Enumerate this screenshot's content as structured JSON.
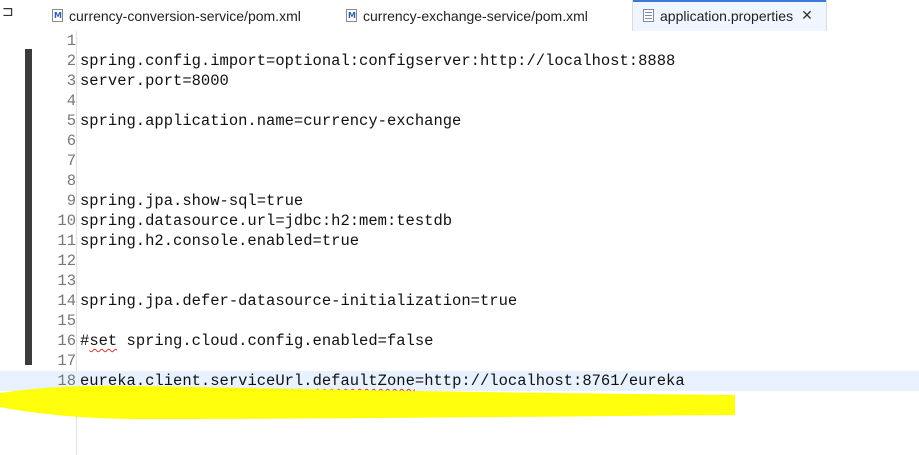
{
  "tabs": [
    {
      "label": "currency-conversion-service/pom.xml",
      "icon": "maven-file-icon",
      "active": false
    },
    {
      "label": "currency-exchange-service/pom.xml",
      "icon": "maven-file-icon",
      "active": false
    },
    {
      "label": "application.properties",
      "icon": "properties-file-icon",
      "active": true
    }
  ],
  "tab_icon_letter": "M",
  "close_glyph": "✕",
  "lines": [
    {
      "n": "1",
      "text": ""
    },
    {
      "n": "2",
      "text": "spring.config.import=optional:configserver:http://localhost:8888"
    },
    {
      "n": "3",
      "text": "server.port=8000"
    },
    {
      "n": "4",
      "text": ""
    },
    {
      "n": "5",
      "text": "spring.application.name=currency-exchange"
    },
    {
      "n": "6",
      "text": ""
    },
    {
      "n": "7",
      "text": ""
    },
    {
      "n": "8",
      "text": ""
    },
    {
      "n": "9",
      "text": "spring.jpa.show-sql=true"
    },
    {
      "n": "10",
      "text": "spring.datasource.url=jdbc:h2:mem:testdb"
    },
    {
      "n": "11",
      "text": "spring.h2.console.enabled=true"
    },
    {
      "n": "12",
      "text": ""
    },
    {
      "n": "13",
      "text": ""
    },
    {
      "n": "14",
      "text": "spring.jpa.defer-datasource-initialization=true"
    },
    {
      "n": "15",
      "text": ""
    },
    {
      "n": "16",
      "text": "#set spring.cloud.config.enabled=false"
    },
    {
      "n": "17",
      "text": ""
    },
    {
      "n": "18",
      "text": "eureka.client.serviceUrl.defaultZone=http://localhost:8761/eureka"
    }
  ],
  "colors": {
    "highlighter": "#ffff00",
    "current_line": "#e8f2fe",
    "active_tab_accent": "#3b78d8"
  }
}
